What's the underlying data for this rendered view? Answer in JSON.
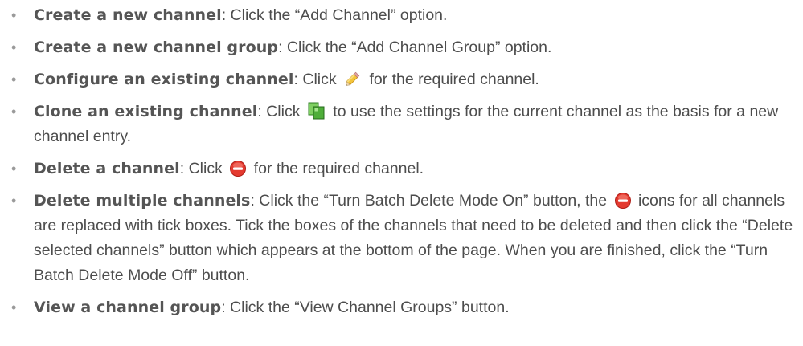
{
  "bullet_glyph": "•",
  "items": [
    {
      "term": "Create a new channel",
      "sep": ":",
      "text": " Click the “Add Channel” option."
    },
    {
      "term": "Create a new channel group",
      "sep": ":",
      "text": " Click the “Add Channel Group” option."
    },
    {
      "term": "Configure an existing channel",
      "sep": ":",
      "text_before": " Click ",
      "icon": "pencil-icon",
      "text_after": " for the required channel."
    },
    {
      "term": "Clone an existing channel",
      "sep": ":",
      "text_before": " Click ",
      "icon": "clone-icon",
      "text_after": " to use the settings for the current channel as the basis for a new channel entry."
    },
    {
      "term": "Delete a channel",
      "sep": ":",
      "text_before": " Click ",
      "icon": "delete-icon",
      "text_after": " for the required channel."
    },
    {
      "term": "Delete multiple channels",
      "sep": ":",
      "text_before": " Click the “Turn Batch Delete Mode On” button, the ",
      "icon": "delete-icon",
      "text_after": " icons for all channels are replaced with tick boxes. Tick the boxes of the channels that need to be deleted and then click the “Delete selected channels” button which appears at the bottom of the page. When you are finished, click the “Turn Batch Delete Mode Off” button."
    },
    {
      "term": "View a channel group",
      "sep": ":",
      "text": " Click the “View Channel Groups” button."
    }
  ],
  "colors": {
    "text": "#4d4d4d",
    "bullet": "#9a9a9a",
    "pencil": "#e8b422",
    "clone": "#3a9a2e",
    "delete": "#e0322a"
  }
}
